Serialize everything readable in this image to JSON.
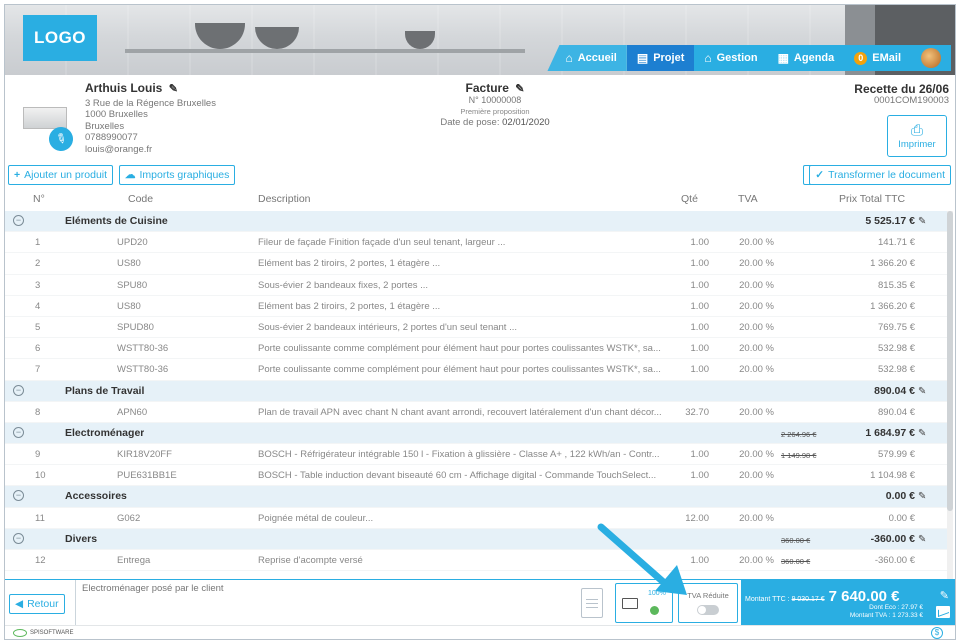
{
  "header": {
    "logo": "LOGO",
    "nav": [
      {
        "label": "Accueil",
        "icon": "home-icon",
        "glyph": "⌂"
      },
      {
        "label": "Projet",
        "icon": "document-icon",
        "glyph": "▤"
      },
      {
        "label": "Gestion",
        "icon": "bank-icon",
        "glyph": "⌂"
      },
      {
        "label": "Agenda",
        "icon": "calendar-icon",
        "glyph": "▦"
      },
      {
        "label": "EMail",
        "icon": "mail-icon",
        "badge": "0"
      }
    ]
  },
  "client": {
    "name": "Arthuis Louis",
    "address1": "3 Rue de la Régence Bruxelles",
    "address2": "1000 Bruxelles",
    "city": "Bruxelles",
    "phone": "0788990077",
    "email": "louis@orange.fr"
  },
  "facture": {
    "title": "Facture",
    "number": "N° 10000008",
    "proposal": "Première proposition",
    "pose_label": "Date de pose:",
    "pose_date": "02/01/2020"
  },
  "recette": {
    "title": "Recette du 26/06",
    "code": "0001COM190003",
    "print_label": "Imprimer"
  },
  "toolbar": {
    "add_product": "Ajouter un produit",
    "imports": "Imports graphiques",
    "transform": "Transformer le document"
  },
  "table": {
    "headers": {
      "n": "N°",
      "code": "Code",
      "desc": "Description",
      "qte": "Qté",
      "tva": "TVA",
      "price": "Prix Total TTC"
    },
    "groups": [
      {
        "name": "Eléments de Cuisine",
        "total": "5 525.17 €",
        "old": "",
        "items": [
          {
            "n": "1",
            "code": "UPD20",
            "desc": "Fileur de façade Finition façade d'un seul tenant, largeur ...",
            "qte": "1.00",
            "tva": "20.00 %",
            "old": "",
            "price": "141.71 €"
          },
          {
            "n": "2",
            "code": "US80",
            "desc": "Elément bas 2 tiroirs, 2 portes, 1 étagère ...",
            "qte": "1.00",
            "tva": "20.00 %",
            "old": "",
            "price": "1 366.20 €"
          },
          {
            "n": "3",
            "code": "SPU80",
            "desc": "Sous-évier 2 bandeaux fixes, 2 portes ...",
            "qte": "1.00",
            "tva": "20.00 %",
            "old": "",
            "price": "815.35 €"
          },
          {
            "n": "4",
            "code": "US80",
            "desc": "Elément bas 2 tiroirs, 2 portes, 1 étagère ...",
            "qte": "1.00",
            "tva": "20.00 %",
            "old": "",
            "price": "1 366.20 €"
          },
          {
            "n": "5",
            "code": "SPUD80",
            "desc": "Sous-évier 2 bandeaux intérieurs, 2 portes d'un seul tenant ...",
            "qte": "1.00",
            "tva": "20.00 %",
            "old": "",
            "price": "769.75 €"
          },
          {
            "n": "6",
            "code": "WSTT80-36",
            "desc": "Porte coulissante comme complément pour élément haut pour portes coulissantes WSTK*, sa...",
            "qte": "1.00",
            "tva": "20.00 %",
            "old": "",
            "price": "532.98 €"
          },
          {
            "n": "7",
            "code": "WSTT80-36",
            "desc": "Porte coulissante comme complément pour élément haut pour portes coulissantes WSTK*, sa...",
            "qte": "1.00",
            "tva": "20.00 %",
            "old": "",
            "price": "532.98 €"
          }
        ]
      },
      {
        "name": "Plans de Travail",
        "total": "890.04 €",
        "old": "",
        "items": [
          {
            "n": "8",
            "code": "APN60",
            "desc": "Plan de travail APN avec chant N chant avant arrondi, recouvert latéralement d'un chant décor...",
            "qte": "32.70",
            "tva": "20.00 %",
            "old": "",
            "price": "890.04 €"
          }
        ]
      },
      {
        "name": "Electroménager",
        "total": "1 684.97 €",
        "old": "2 264.96 €",
        "items": [
          {
            "n": "9",
            "code": "KIR18V20FF",
            "desc": "BOSCH - Réfrigérateur intégrable 150 l - Fixation à glissière - Classe A+ , 122 kWh/an - Contr...",
            "qte": "1.00",
            "tva": "20.00 %",
            "old": "1 149.98 €",
            "price": "579.99 €"
          },
          {
            "n": "10",
            "code": "PUE631BB1E",
            "desc": "BOSCH - Table induction devant biseauté 60 cm - Affichage digital - Commande TouchSelect...",
            "qte": "1.00",
            "tva": "20.00 %",
            "old": "",
            "price": "1 104.98 €"
          }
        ]
      },
      {
        "name": "Accessoires",
        "total": "0.00 €",
        "old": "",
        "items": [
          {
            "n": "11",
            "code": "G062",
            "desc": "Poignée métal de couleur...",
            "qte": "12.00",
            "tva": "20.00 %",
            "old": "",
            "price": "0.00 €"
          }
        ]
      },
      {
        "name": "Divers",
        "total": "-360.00 €",
        "old": "360.00 €",
        "items": [
          {
            "n": "12",
            "code": "Entrega",
            "desc": "Reprise d'acompte versé",
            "qte": "1.00",
            "tva": "20.00 %",
            "old": "360.00 €",
            "price": "-360.00 €"
          }
        ]
      }
    ]
  },
  "footer": {
    "retour": "Retour",
    "note": "Electroménager posé par le client",
    "payment_pct": "100%",
    "tva_label": "TVA Réduite",
    "total_label": "Montant TTC :",
    "total_old": "9 030.17 €",
    "total_new": "7 640.00 €",
    "eco": "Dont Eco : 27.97 €",
    "tva_amount": "Montant TVA : 1 273.33 €"
  },
  "statusbar": {
    "brand": "SPISOFTWARE"
  },
  "colors": {
    "accent": "#2aaee2",
    "group_bg": "#e6f1f8",
    "nav_active": "#1d7fd1"
  }
}
